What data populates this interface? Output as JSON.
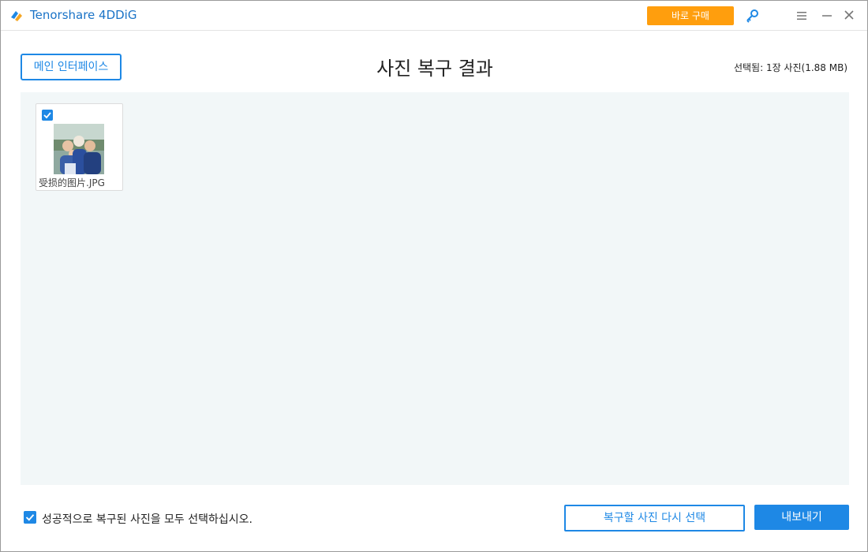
{
  "app": {
    "title": "Tenorshare 4DDiG",
    "logo_icon": "4ddig-logo-icon",
    "brand_color": "#1a73c7"
  },
  "titlebar": {
    "buy_label": "바로 구매",
    "buy_color": "#ff9e0d",
    "icons": [
      "key-icon",
      "menu-icon",
      "minimize-icon",
      "close-icon"
    ]
  },
  "header": {
    "main_interface_label": "메인 인터페이스",
    "page_title": "사진 복구 결과",
    "selection_info": "선택됨: 1장 사진(1.88 MB)"
  },
  "photos": [
    {
      "name": "受损的图片.JPG",
      "checked": true
    }
  ],
  "footer": {
    "select_all_label": "성공적으로 복구된 사진을 모두 선택하십시오.",
    "select_all_checked": true,
    "reselect_label": "복구할 사진 다시 선택",
    "export_label": "내보내기"
  },
  "colors": {
    "accent": "#1e88e5",
    "content_bg": "#f2f7f8"
  }
}
